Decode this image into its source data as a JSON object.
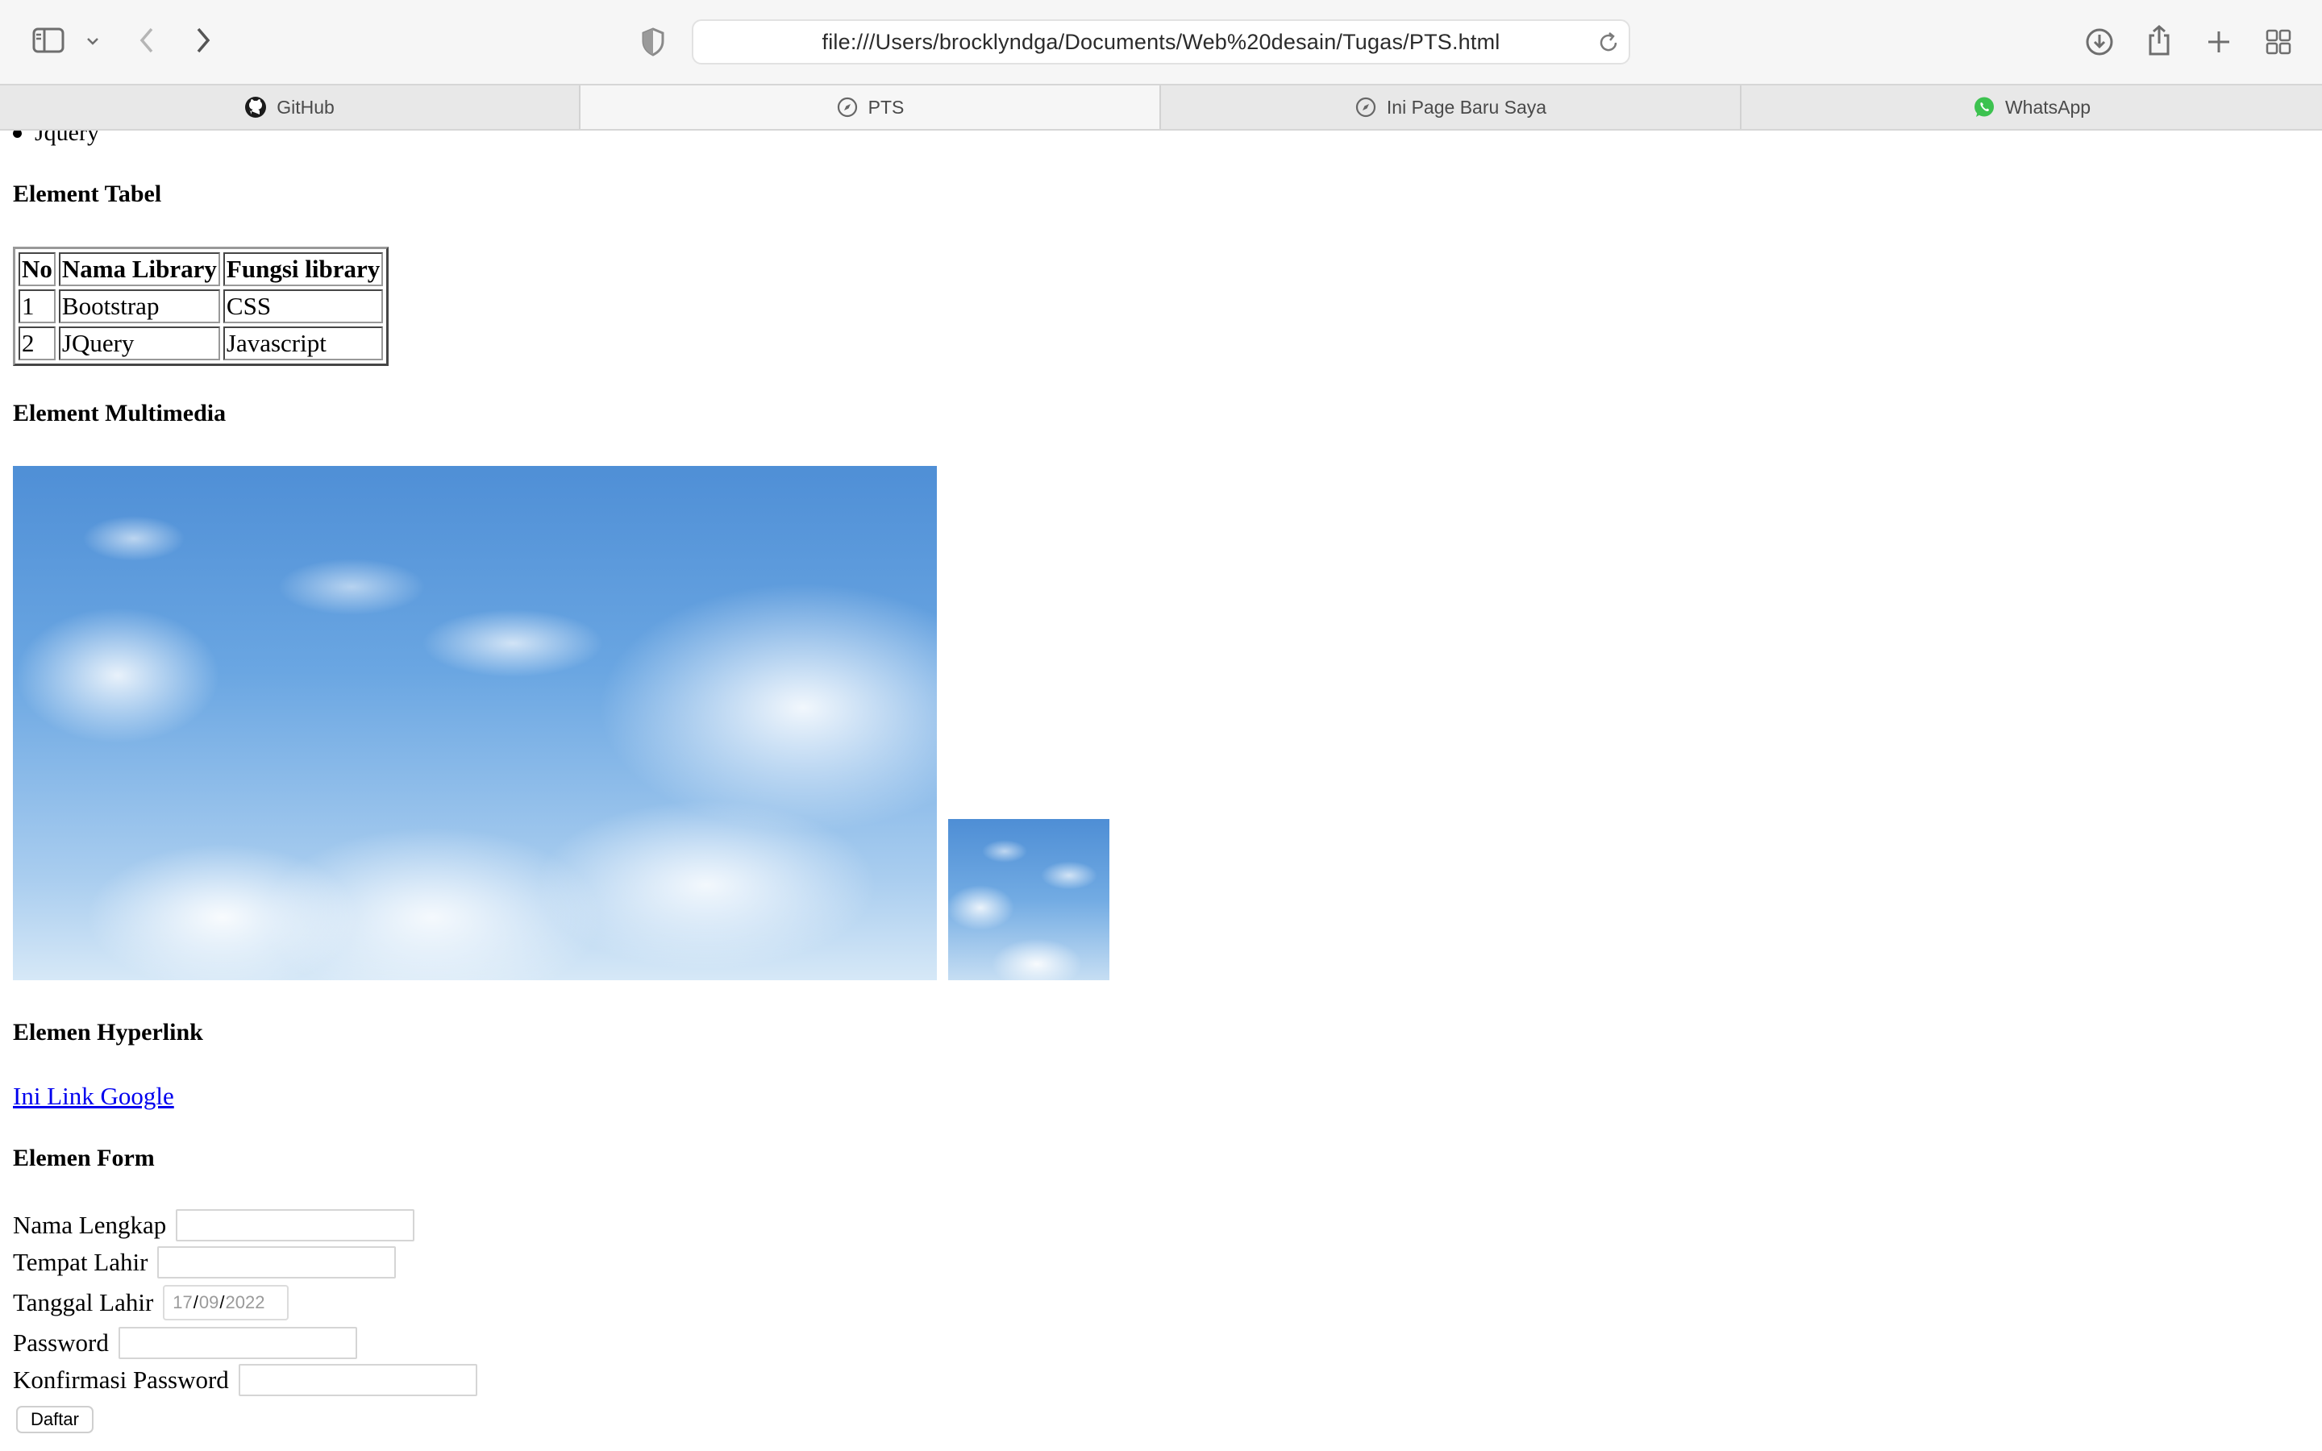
{
  "browser": {
    "url": "file:///Users/brocklyndga/Documents/Web%20desain/Tugas/PTS.html",
    "tabs": [
      {
        "label": "GitHub",
        "icon": "github-icon",
        "active": false
      },
      {
        "label": "PTS",
        "icon": "compass-icon",
        "active": true
      },
      {
        "label": "Ini Page Baru Saya",
        "icon": "compass-icon",
        "active": false
      },
      {
        "label": "WhatsApp",
        "icon": "whatsapp-icon",
        "active": false
      }
    ]
  },
  "content": {
    "list_last_item": "Jquery",
    "table_heading": "Element Tabel",
    "table": {
      "headers": [
        "No",
        "Nama Library",
        "Fungsi library"
      ],
      "rows": [
        [
          "1",
          "Bootstrap",
          "CSS"
        ],
        [
          "2",
          "JQuery",
          "Javascript"
        ]
      ]
    },
    "multimedia_heading": "Element Multimedia",
    "hyperlink_heading": "Elemen Hyperlink",
    "link_text": "Ini Link Google",
    "form_heading": "Elemen Form",
    "form": {
      "nama_label": "Nama Lengkap",
      "tempat_label": "Tempat Lahir",
      "tanggal_label": "Tanggal Lahir",
      "date_day": "17",
      "date_month": "09",
      "date_year": "2022",
      "password_label": "Password",
      "konfirmasi_label": "Konfirmasi Password",
      "submit_label": "Daftar"
    }
  }
}
